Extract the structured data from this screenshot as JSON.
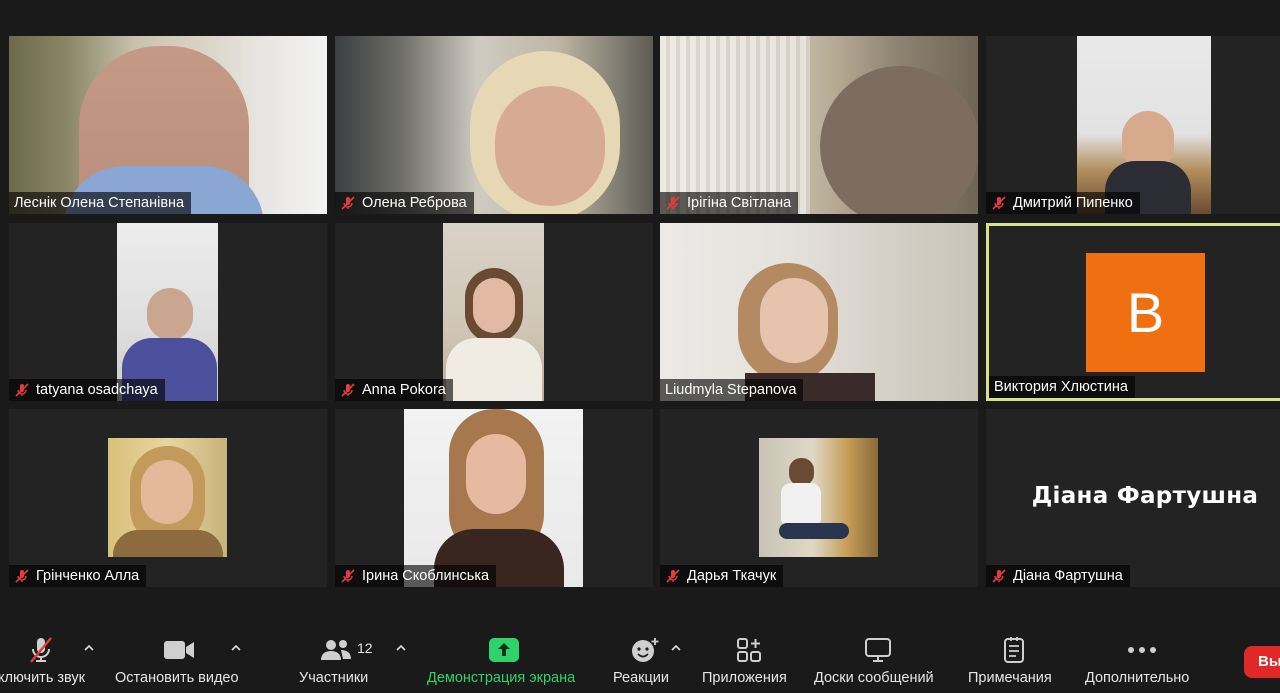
{
  "participants": [
    {
      "name": "Леснік Олена Степанівна",
      "muted": false
    },
    {
      "name": "Олена Реброва",
      "muted": true
    },
    {
      "name": "Ірігіна  Світлана",
      "muted": true
    },
    {
      "name": "Дмитрий Пипенко",
      "muted": true
    },
    {
      "name": "tatyana osadchaya",
      "muted": true
    },
    {
      "name": "Anna Pokora",
      "muted": true
    },
    {
      "name": "Liudmyla Stepanova",
      "muted": false
    },
    {
      "name": "Виктория Хлюстина",
      "muted": false,
      "avatar_letter": "B",
      "avatar_color": "#f07011",
      "active_speaker": true
    },
    {
      "name": "Грінченко Алла",
      "muted": true
    },
    {
      "name": "Ірина Скоблинська",
      "muted": true
    },
    {
      "name": "Дарья Ткачук",
      "muted": true
    },
    {
      "name": "Діана Фартушна",
      "muted": true,
      "video_off_name": "Діана Фартушна"
    }
  ],
  "toolbar": {
    "mute_label": "ключить звук",
    "video_label": "Остановить видео",
    "participants_label": "Участники",
    "participants_count": "12",
    "share_label": "Демонстрация экрана",
    "reactions_label": "Реакции",
    "apps_label": "Приложения",
    "whiteboards_label": "Доски сообщений",
    "notes_label": "Примечания",
    "more_label": "Дополнительно",
    "end_label": "Вы"
  },
  "colors": {
    "share_green": "#2fd36a",
    "end_red": "#e02828",
    "active_outline": "#d7e08a",
    "muted_red": "#e83a3a"
  },
  "icons": [
    "mic-off-icon",
    "video-icon",
    "participants-icon",
    "share-screen-icon",
    "reactions-icon",
    "apps-icon",
    "whiteboards-icon",
    "notes-icon",
    "more-icon",
    "chevron-up-icon"
  ]
}
